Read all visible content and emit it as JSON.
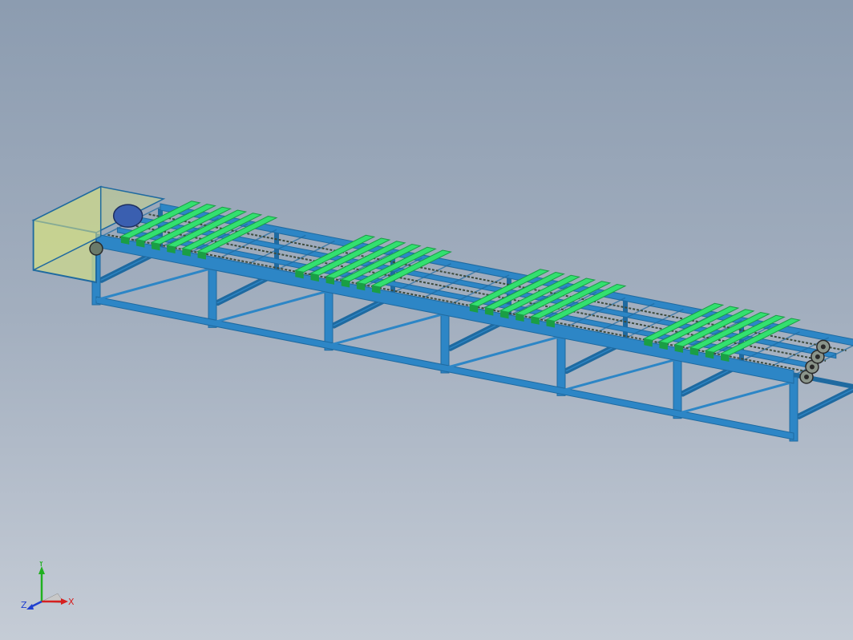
{
  "view": {
    "background_top": "#8c9cb0",
    "background_bottom": "#c5ccd6"
  },
  "model": {
    "frame_color": "#2d86c6",
    "frame_dark": "#1f6aa0",
    "slat_color": "#33e070",
    "slat_dark": "#1a9e45",
    "chain_color": "#3b4a3c",
    "guard_color": "#c9d68e",
    "motor_color": "#3a5fb0",
    "slat_groups": 4,
    "slats_per_group": 6
  },
  "triad": {
    "x_label": "X",
    "y_label": "Y",
    "z_label": "Z",
    "x_color": "#d62020",
    "y_color": "#20b020",
    "z_color": "#2040d0",
    "icon": "coordinate-triad-icon"
  }
}
